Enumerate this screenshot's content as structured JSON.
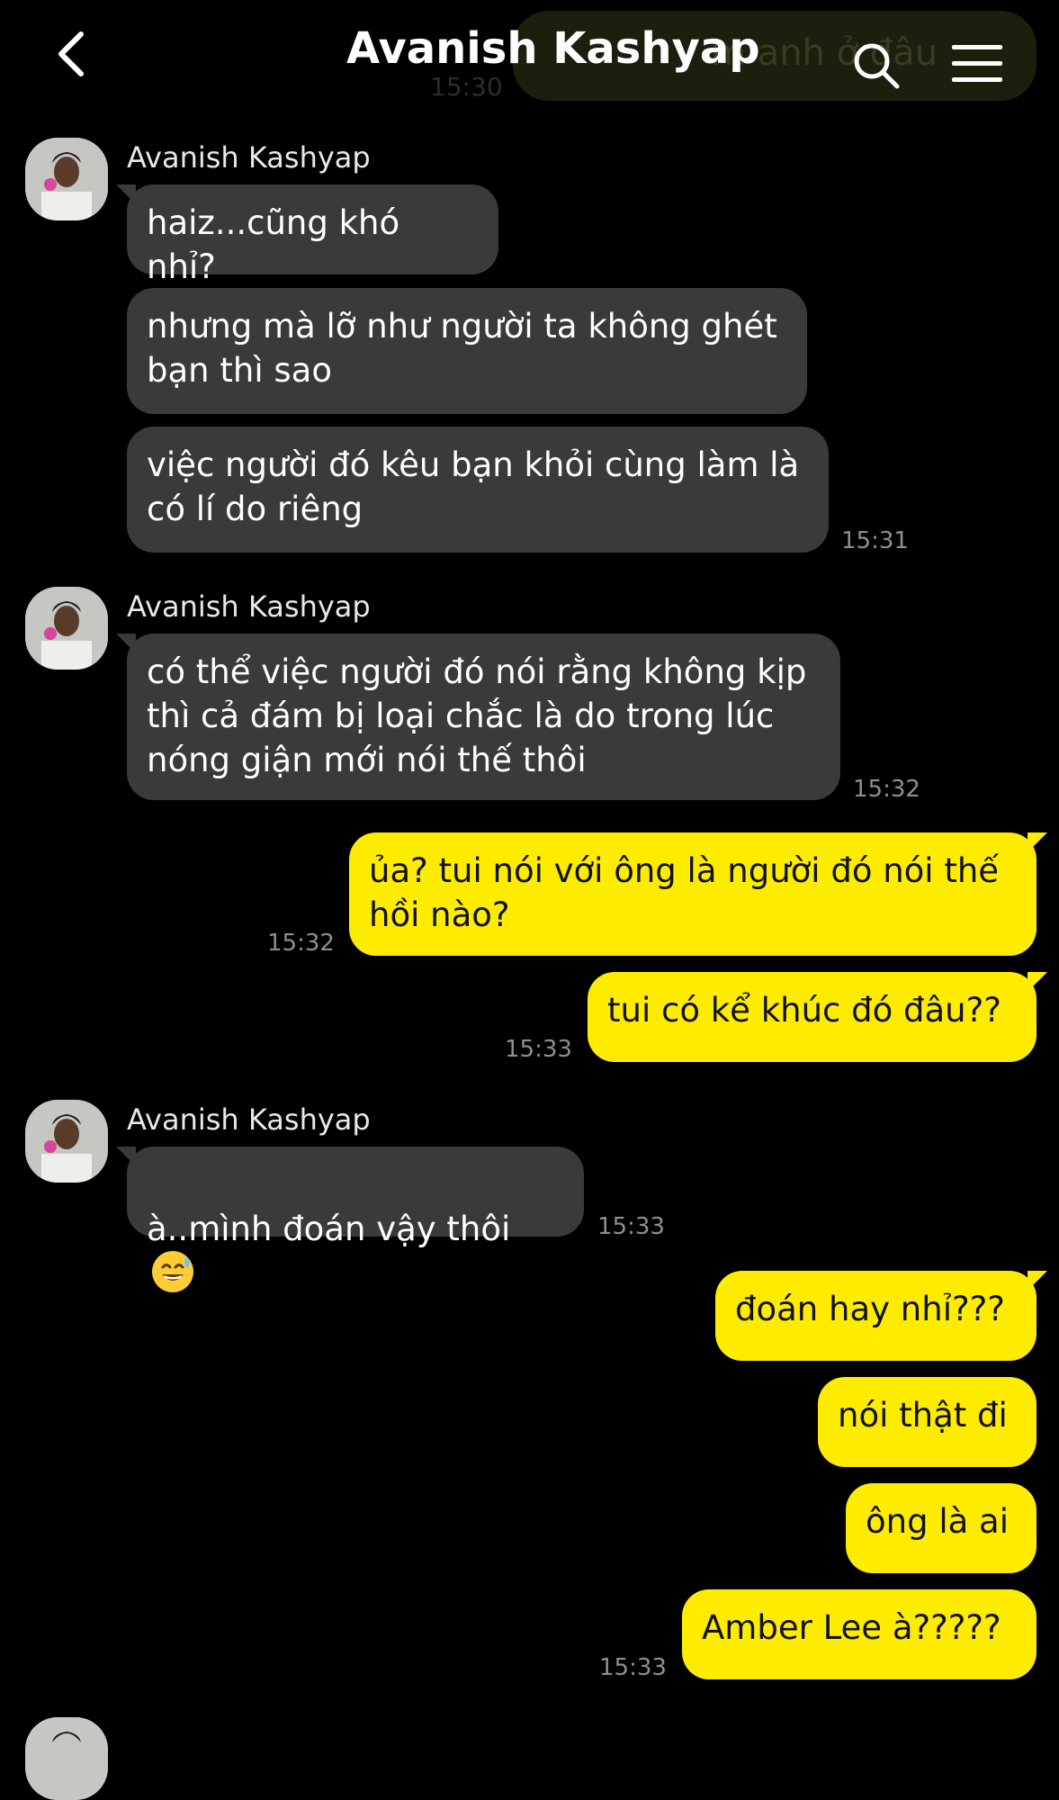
{
  "header": {
    "title": "Avanish Kashyap",
    "ghost_text": "m anh ở đâu",
    "ghost_time": "15:30"
  },
  "groups": [
    {
      "sender": "Avanish Kashyap",
      "messages": [
        "haiz...cũng khó nhỉ?",
        "nhưng mà lỡ như người ta không ghét\nbạn thì sao",
        "việc người đó kêu bạn khỏi cùng làm là\ncó lí do riêng"
      ],
      "time": "15:31"
    },
    {
      "sender": "Avanish Kashyap",
      "messages": [
        "có thể việc người đó nói rằng không kịp\nthì cả đám bị loại chắc là do trong lúc\nnóng giận mới nói thế thôi"
      ],
      "time": "15:32"
    },
    {
      "outgoing": true,
      "messages": [
        "ủa? tui nói với ông là người đó nói thế\nhồi nào?"
      ],
      "time": "15:32"
    },
    {
      "outgoing": true,
      "messages": [
        "tui có kể khúc đó đâu??"
      ],
      "time": "15:33"
    },
    {
      "sender": "Avanish Kashyap",
      "messages": [
        "à..mình đoán vậy thôi"
      ],
      "emoji": "sweat-smile-emoji",
      "time": "15:33"
    },
    {
      "outgoing": true,
      "messages": [
        "đoán hay nhỉ???",
        "nói thật đi",
        "ông là ai",
        "Amber Lee à?????"
      ],
      "time": "15:33"
    }
  ],
  "colors": {
    "background": "#000000",
    "incoming_bubble": "#3a3a3c",
    "outgoing_bubble": "#fdec00",
    "timestamp": "#8e8e93"
  },
  "icons": [
    "back-chevron-icon",
    "search-icon",
    "menu-icon"
  ]
}
